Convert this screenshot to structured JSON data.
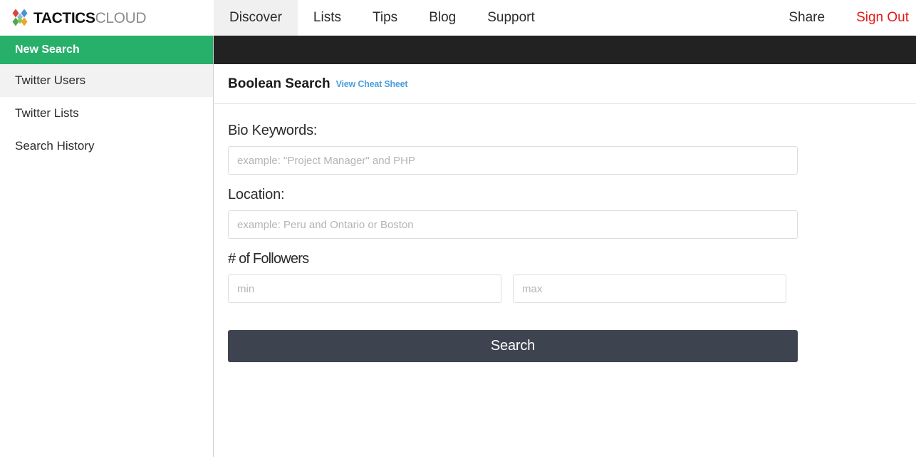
{
  "brand": {
    "name_bold": "TACTICS",
    "name_light": "CLOUD",
    "logo_icon": "diamond-cluster-logo",
    "logo_colors": [
      "#d9443f",
      "#4a90d9",
      "#4fa84f",
      "#f0a32e"
    ]
  },
  "nav": {
    "items": [
      {
        "label": "Discover",
        "active": true
      },
      {
        "label": "Lists",
        "active": false
      },
      {
        "label": "Tips",
        "active": false
      },
      {
        "label": "Blog",
        "active": false
      },
      {
        "label": "Support",
        "active": false
      }
    ],
    "right": [
      {
        "label": "Share",
        "style": "normal"
      },
      {
        "label": "Sign Out",
        "style": "danger"
      }
    ],
    "active_bg": "#f0f0f0",
    "danger_color": "#e01b18"
  },
  "sidebar": {
    "items": [
      {
        "label": "New Search",
        "state": "highlight"
      },
      {
        "label": "Twitter Users",
        "state": "selected"
      },
      {
        "label": "Twitter Lists",
        "state": "normal"
      },
      {
        "label": "Search History",
        "state": "normal"
      }
    ],
    "highlight_color": "#27b069",
    "selected_bg": "#f2f2f2"
  },
  "panel": {
    "title": "Boolean Search",
    "cheat_sheet_link": "View Cheat Sheet",
    "link_color": "#4a9fe0"
  },
  "form": {
    "bio": {
      "label": "Bio Keywords:",
      "placeholder": "example: \"Project Manager\" and PHP",
      "value": ""
    },
    "location": {
      "label": "Location:",
      "placeholder": "example: Peru and Ontario or Boston",
      "value": ""
    },
    "followers": {
      "label": "# of Followers",
      "min_placeholder": "min",
      "min_value": "",
      "max_placeholder": "max",
      "max_value": ""
    },
    "submit_label": "Search",
    "submit_color": "#3e4350"
  },
  "strip": {
    "color": "#222222"
  }
}
